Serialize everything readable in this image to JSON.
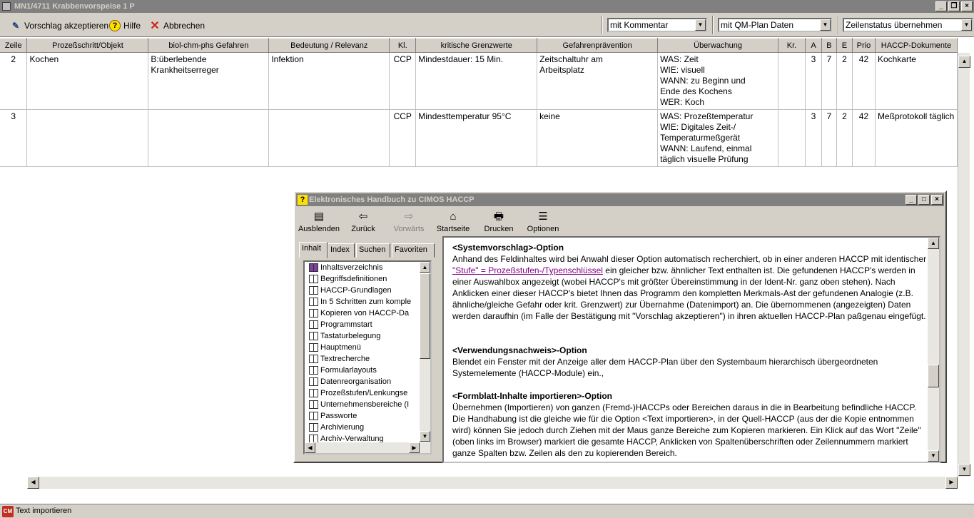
{
  "window": {
    "title": "MN1/4711  Krabbenvorspeise  1  P"
  },
  "toolbar": {
    "accept_label": "Vorschlag akzeptieren",
    "help_label": "Hilfe",
    "cancel_label": "Abbrechen",
    "combo1": "mit Kommentar",
    "combo2": "mit QM-Plan Daten",
    "combo3": "Zeilenstatus übernehmen"
  },
  "table": {
    "headers": [
      "Zeile",
      "Prozeßschritt/Objekt",
      "biol-chm-phs Gefahren",
      "Bedeutung / Relevanz",
      "Kl.",
      "kritische Grenzwerte",
      "Gefahrenprävention",
      "Überwachung",
      "Kr.",
      "A",
      "B",
      "E",
      "Prio",
      "HACCP-Dokumente"
    ],
    "rows": [
      [
        "2",
        "Kochen",
        "B:überlebende\nKrankheitserreger",
        "Infektion",
        "CCP",
        "Mindestdauer: 15 Min.",
        "Zeitschaltuhr am\nArbeitsplatz",
        "WAS: Zeit\nWIE: visuell\nWANN: zu Beginn und\nEnde des Kochens\nWER: Koch",
        "",
        "3",
        "7",
        "2",
        "42",
        "Kochkarte"
      ],
      [
        "3",
        "",
        "",
        "",
        "CCP",
        "Mindesttemperatur 95°C",
        "keine",
        "WAS: Prozeßtemperatur\nWIE: Digitales Zeit-/\nTemperaturmeßgerät\nWANN: Laufend, einmal\ntäglich visuelle Prüfung",
        "",
        "3",
        "7",
        "2",
        "42",
        "Meßprotokoll täglich"
      ]
    ]
  },
  "status": {
    "text": "Text importieren"
  },
  "help": {
    "title": "Elektronisches Handbuch zu CIMOS HACCP",
    "buttons": [
      "Ausblenden",
      "Zurück",
      "Vorwärts",
      "Startseite",
      "Drucken",
      "Optionen"
    ],
    "tabs": [
      "Inhalt",
      "Index",
      "Suchen",
      "Favoriten"
    ],
    "tree": [
      "Inhaltsverzeichnis",
      "Begriffsdefinitionen",
      "HACCP-Grundlagen",
      "In 5 Schritten zum komple",
      "Kopieren von HACCP-Da",
      "Programmstart",
      "Tastaturbelegung",
      "Hauptmenü",
      "Textrecherche",
      "Formularlayouts",
      "Datenreorganisation",
      "Prozeßstufen/Lenkungse",
      "Unternehmensbereiche (I",
      "Passworte",
      "Archivierung",
      "Archiv-Verwaltung"
    ],
    "sections": {
      "s1_heading": "<Systemvorschlag>-Option",
      "s1_p1a": "Anhand des Feldinhaltes wird bei Anwahl dieser Option automatisch recherchiert, ob in einer anderen HACCP mit identischer ",
      "s1_link": "\"Stufe\" = Prozeßstufen-/Typenschlüssel",
      "s1_p1b": " ein gleicher bzw. ähnlicher Text enthalten ist. Die gefundenen HACCP's werden in einer Auswahlbox angezeigt (wobei HACCP's mit größter Übereinstimmung in der Ident-Nr. ganz oben stehen). Nach Anklicken einer dieser HACCP's bietet Ihnen das Programm den kompletten Merkmals-Ast der gefundenen Analogie (z.B. ähnliche/gleiche Gefahr oder krit. Grenzwert) zur Übernahme (Datenimport) an. Die übernommenen (angezeigten) Daten werden daraufhin (im Falle der Bestätigung mit \"Vorschlag akzeptieren\") in ihren aktuellen HACCP-Plan paßgenau eingefügt.",
      "s2_heading": "<Verwendungsnachweis>-Option",
      "s2_p": "Blendet ein Fenster mit der Anzeige aller dem HACCP-Plan über den Systembaum hierarchisch übergeordneten Systemelemente (HACCP-Module) ein.,",
      "s3_heading": "<Formblatt-Inhalte importieren>-Option",
      "s3_p": "Übernehmen (Importieren) von ganzen (Fremd-)HACCPs oder Bereichen daraus in die in Bearbeitung befindliche HACCP. Die Handhabung ist die gleiche wie für die Option <Text importieren>, in der Quell-HACCP (aus der die Kopie entnommen wird) können Sie jedoch durch Ziehen mit der Maus ganze Bereiche zum Kopieren markieren. Ein Klick auf das Wort \"Zeile\" (oben links im Browser) markiert die gesamte HACCP, Anklicken von Spaltenüberschriften oder Zeilennummern markiert ganze Spalten bzw. Zeilen als den zu kopierenden Bereich."
    }
  }
}
